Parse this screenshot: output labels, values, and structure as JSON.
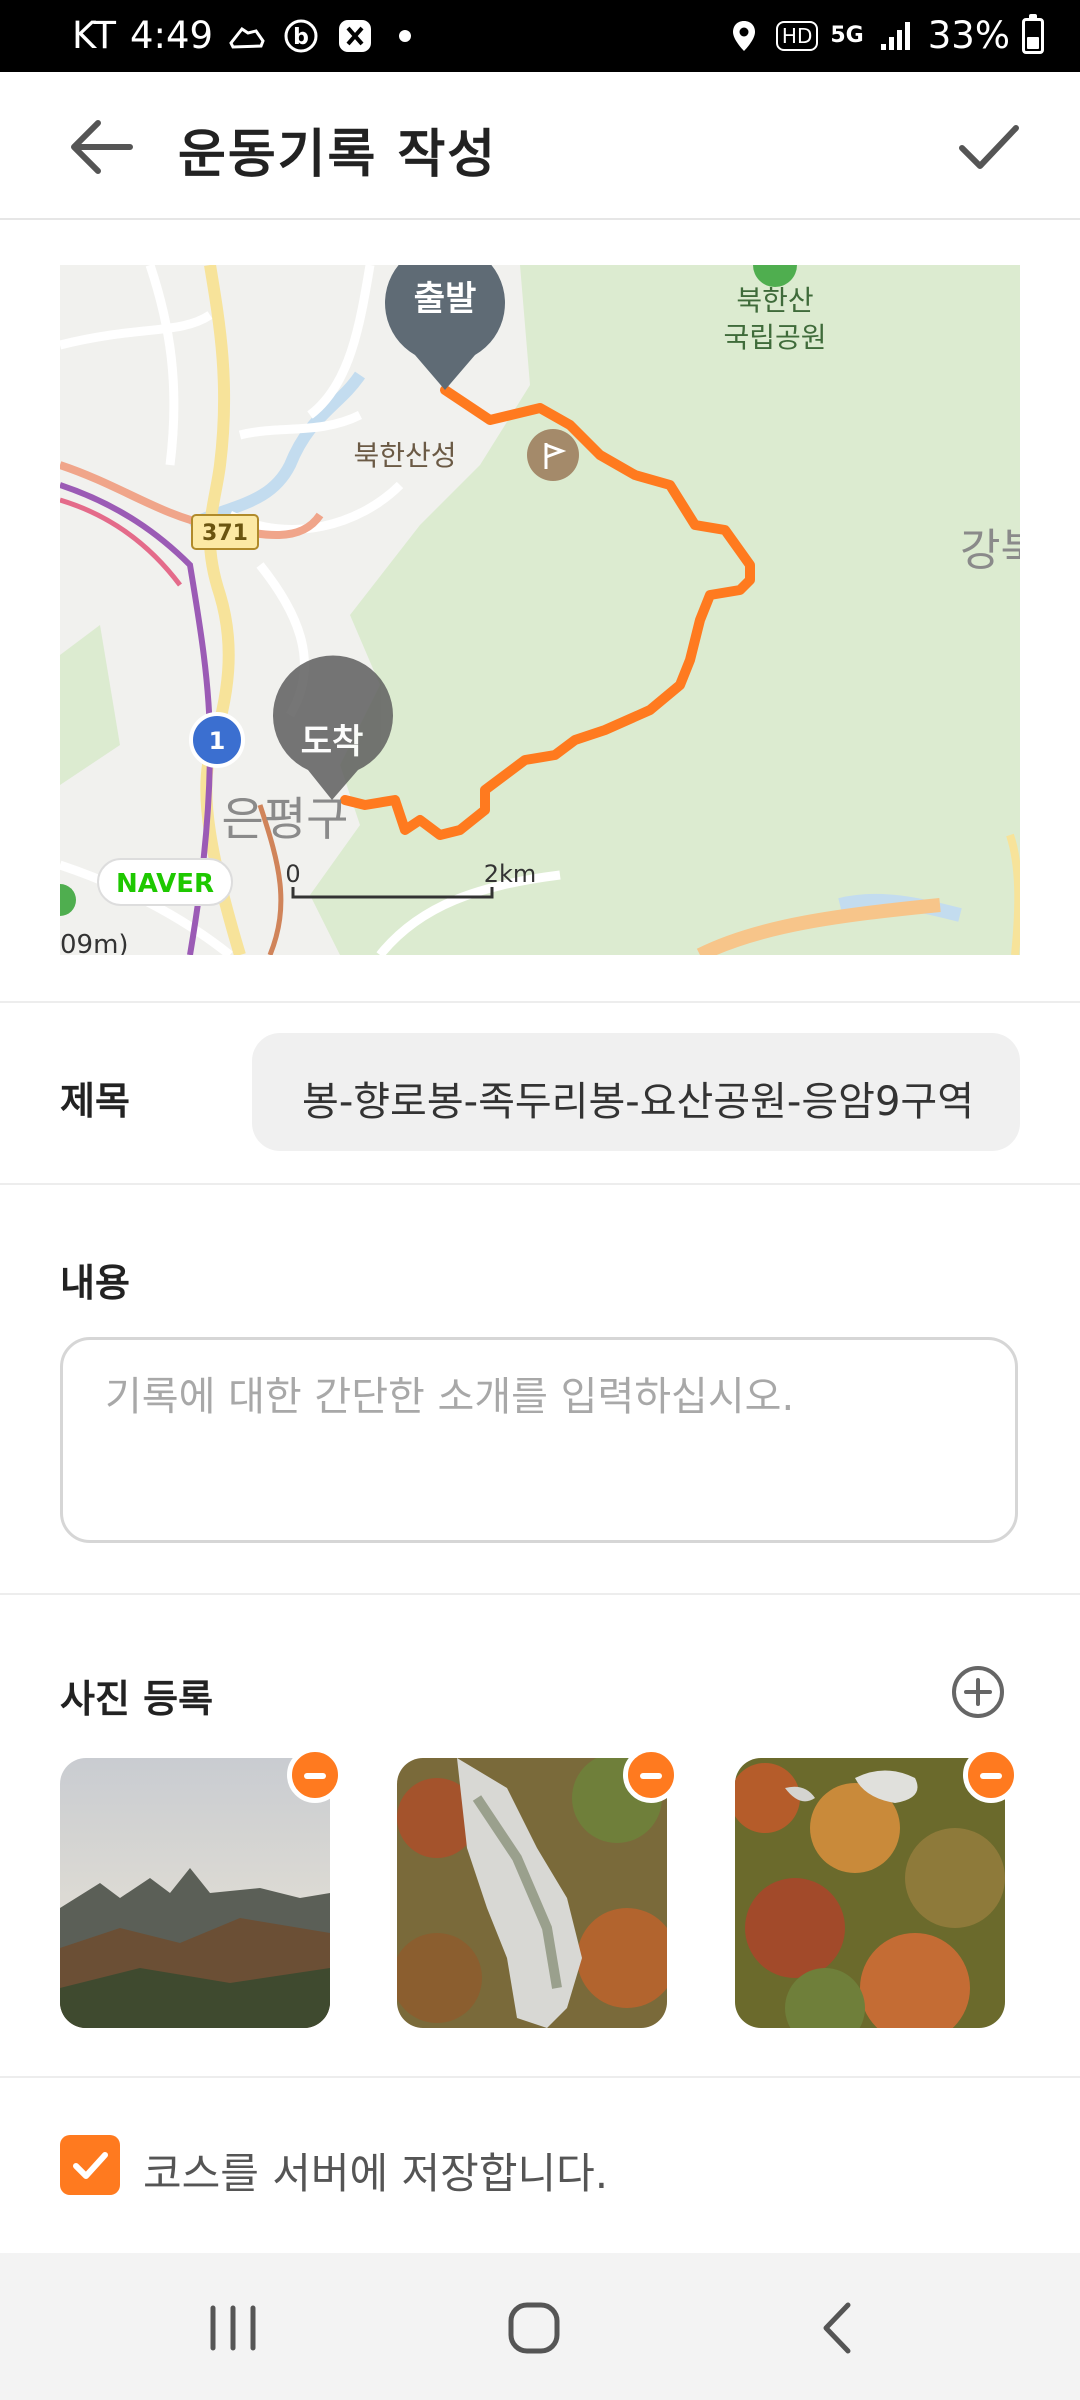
{
  "status_bar": {
    "carrier": "KT",
    "time": "4:49",
    "hd_badge": "HD",
    "network": "5G",
    "battery": "33%"
  },
  "app_bar": {
    "title": "운동기록 작성",
    "back_icon": "arrow-left-icon",
    "confirm_icon": "check-icon"
  },
  "map": {
    "start_marker": "출발",
    "end_marker": "도착",
    "place_park": "북한산\n국립공원",
    "place_fortress": "북한산성",
    "place_district": "은평구",
    "place_partial": "강북",
    "road_371": "371",
    "road_1": "1",
    "brand": "NAVER",
    "scale_zero": "0",
    "scale_distance": "2km",
    "edge_label": "09m)",
    "route_color": "#ff7a1f"
  },
  "form": {
    "title_label": "제목",
    "title_value": "봉-향로봉-족두리봉-요산공원-응암9구역",
    "content_label": "내용",
    "content_placeholder": "기록에 대한 간단한 소개를 입력하십시오.",
    "photo_label": "사진 등록",
    "add_photo_icon": "plus-circle-icon",
    "photos": [
      {
        "name": "mountain-ridge-photo"
      },
      {
        "name": "rock-slope-photo"
      },
      {
        "name": "autumn-forest-photo"
      }
    ],
    "save_course_checked": true,
    "save_course_label": "코스를 서버에 저장합니다."
  },
  "nav_bar": {
    "recent_icon": "recent-apps-icon",
    "home_icon": "home-icon",
    "back_icon": "back-icon"
  },
  "colors": {
    "accent": "#ff7a1f",
    "park_green": "#dcebd0"
  }
}
